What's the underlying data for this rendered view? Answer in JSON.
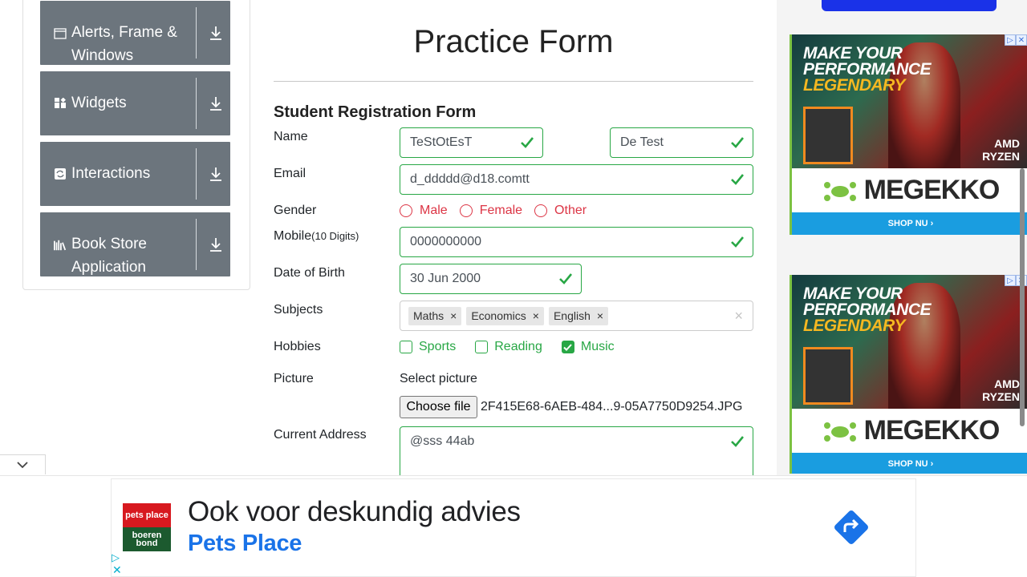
{
  "sidebar": {
    "groups": [
      {
        "label_line1": "Alerts, Frame &",
        "label_line2": "Windows",
        "icon": "window-icon"
      },
      {
        "label": "Widgets",
        "icon": "widgets-icon"
      },
      {
        "label": "Interactions",
        "icon": "interactions-icon"
      },
      {
        "label_line1": "Book Store",
        "label_line2": "Application",
        "icon": "books-icon"
      }
    ]
  },
  "form": {
    "title": "Practice Form",
    "subtitle": "Student Registration Form",
    "labels": {
      "name": "Name",
      "email": "Email",
      "gender": "Gender",
      "mobile": "Mobile",
      "mobile_hint": "(10 Digits)",
      "dob": "Date of Birth",
      "subjects": "Subjects",
      "hobbies": "Hobbies",
      "picture": "Picture",
      "address": "Current Address"
    },
    "first_name": "TeStOtEsT",
    "last_name": "De Test",
    "email": "d_ddddd@d18.comtt",
    "gender_options": [
      "Male",
      "Female",
      "Other"
    ],
    "mobile": "0000000000",
    "dob": "30 Jun 2000",
    "subjects": [
      "Maths",
      "Economics",
      "English"
    ],
    "subject_remove": "×",
    "subjects_clear": "×",
    "hobbies": [
      {
        "label": "Sports",
        "checked": false
      },
      {
        "label": "Reading",
        "checked": false
      },
      {
        "label": "Music",
        "checked": true
      }
    ],
    "select_picture": "Select picture",
    "choose_file": "Choose file",
    "file_name": "2F415E68-6AEB-484...9-05A7750D9254.JPG",
    "address": "@sss 44ab"
  },
  "right_ads": {
    "headline_line1": "MAKE YOUR",
    "headline_line2": "PERFORMANCE",
    "headline_line3": "LEGENDARY",
    "amd_line1": "AMD",
    "amd_line2": "RYZEN",
    "brand": "MEGEKKO",
    "shop": "SHOP NU ›"
  },
  "bottom_ad": {
    "headline": "Ook voor deskundig advies",
    "advertiser": "Pets Place",
    "logo_top": "pets place",
    "logo_bottom": "boeren bond",
    "play": "▷",
    "close": "✕"
  },
  "colors": {
    "valid": "#28a745",
    "invalid": "#dc3545",
    "sidebar_group": "#6c757d",
    "ad_link": "#1a73e8"
  }
}
